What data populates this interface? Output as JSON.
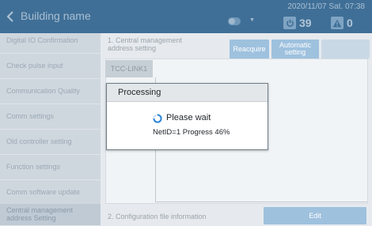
{
  "header": {
    "title": "Building name",
    "datetime": "2020/11/07 Sat. 07:38",
    "power_count": "39",
    "alert_count": "0"
  },
  "sidebar": {
    "items": [
      {
        "label": "Digital IO Confirmation"
      },
      {
        "label": "Check pulse input"
      },
      {
        "label": "Communication Quality"
      },
      {
        "label": "Comm settings"
      },
      {
        "label": "Old controller setting"
      },
      {
        "label": "Function settings"
      },
      {
        "label": "Comm software update"
      },
      {
        "label": "Central management address Setting"
      }
    ]
  },
  "main": {
    "section1_label": "1. Central management address setting",
    "reacquire_label": "Reacquire",
    "automatic_setting_label": "Automatic setting",
    "table_tab_label": "TCC-LINK1",
    "section2_label": "2. Configuration file information",
    "edit_label": "Edit"
  },
  "dialog": {
    "title": "Processing",
    "message": "Please wait",
    "progress_text": "NetID=1  Progress 46%"
  },
  "colors": {
    "header_bg": "#3f6f97",
    "button_bg": "#9ec1de",
    "spinner": "#2f86d6"
  },
  "icons": {
    "back": "chevron-left-icon",
    "toggle": "toggle-icon",
    "power": "power-icon",
    "alert": "alert-triangle-icon",
    "spinner": "spinner-icon"
  }
}
